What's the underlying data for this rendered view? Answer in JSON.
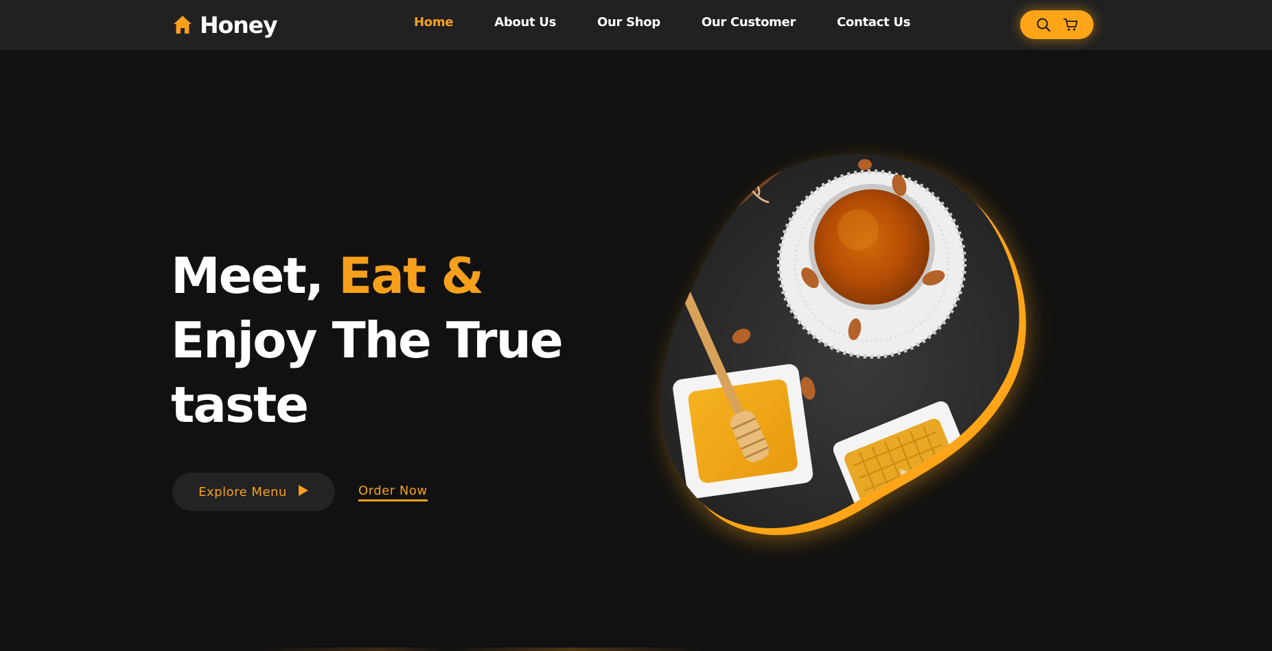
{
  "brand": {
    "name": "Honey",
    "icon": "home-icon"
  },
  "nav": {
    "items": [
      {
        "label": "Home",
        "active": true
      },
      {
        "label": "About Us",
        "active": false
      },
      {
        "label": "Our Shop",
        "active": false
      },
      {
        "label": "Our Customer",
        "active": false
      },
      {
        "label": "Contact Us",
        "active": false
      }
    ],
    "actions": [
      {
        "icon": "search-icon"
      },
      {
        "icon": "cart-icon"
      }
    ]
  },
  "hero": {
    "title_part1": "Meet,",
    "title_accent": "Eat &",
    "title_line2": "Enjoy The True",
    "title_line3": "taste",
    "explore_label": "Explore Menu",
    "order_label": "Order Now",
    "image_icon": "honey-blob-image"
  },
  "colors": {
    "accent": "#f7a01c",
    "background": "#111111",
    "navbar": "#212121",
    "button_dark": "#232323"
  }
}
